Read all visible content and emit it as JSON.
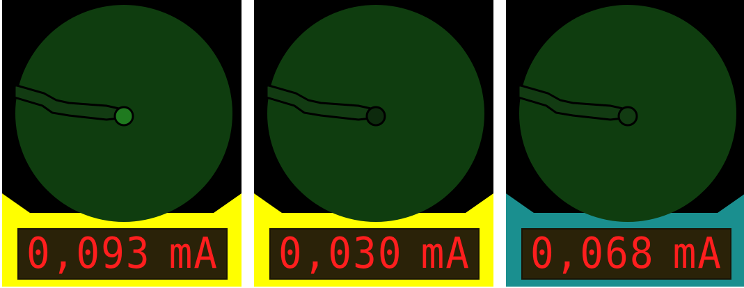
{
  "meters": [
    {
      "value": "0,093",
      "unit": "mA",
      "base_color": "#ffff00",
      "bulb_color": "#1f7a1f"
    },
    {
      "value": "0,030",
      "unit": "mA",
      "base_color": "#ffff00",
      "bulb_color": "#0d2a0d"
    },
    {
      "value": "0,068",
      "unit": "mA",
      "base_color": "#1a8f8f",
      "bulb_color": "#123b12"
    }
  ],
  "colors": {
    "background": "#000000",
    "dial_face": "#0f3d0f",
    "needle": "#123b12",
    "needle_outline": "#000000",
    "readout_digits": "#ff1e1e"
  }
}
